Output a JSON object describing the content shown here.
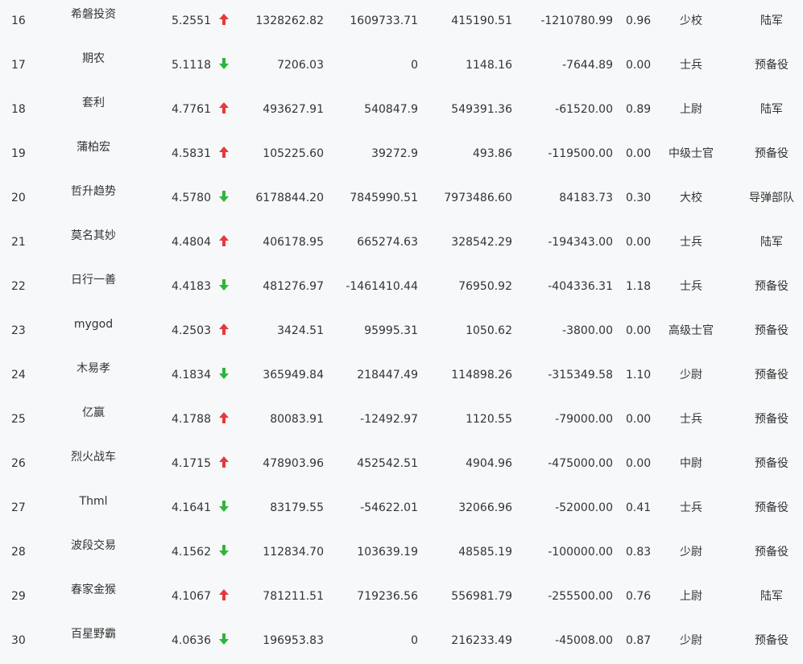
{
  "colors": {
    "up": "#e5393b",
    "down": "#2fb53a",
    "background": "#f7f8fa",
    "text": "#333333"
  },
  "rows": [
    {
      "rank": "16",
      "name": "希磐投资",
      "score": "5.2551",
      "trend": "up",
      "v1": "1328262.82",
      "v2": "1609733.71",
      "v3": "415190.51",
      "v4": "-1210780.99",
      "ratio": "0.96",
      "title": "少校",
      "dept": "陆军"
    },
    {
      "rank": "17",
      "name": "期农",
      "score": "5.1118",
      "trend": "down",
      "v1": "7206.03",
      "v2": "0",
      "v3": "1148.16",
      "v4": "-7644.89",
      "ratio": "0.00",
      "title": "士兵",
      "dept": "预备役"
    },
    {
      "rank": "18",
      "name": "套利",
      "score": "4.7761",
      "trend": "up",
      "v1": "493627.91",
      "v2": "540847.9",
      "v3": "549391.36",
      "v4": "-61520.00",
      "ratio": "0.89",
      "title": "上尉",
      "dept": "陆军"
    },
    {
      "rank": "19",
      "name": "蒲柏宏",
      "score": "4.5831",
      "trend": "up",
      "v1": "105225.60",
      "v2": "39272.9",
      "v3": "493.86",
      "v4": "-119500.00",
      "ratio": "0.00",
      "title": "中级士官",
      "dept": "预备役"
    },
    {
      "rank": "20",
      "name": "哲升趋势",
      "score": "4.5780",
      "trend": "down",
      "v1": "6178844.20",
      "v2": "7845990.51",
      "v3": "7973486.60",
      "v4": "84183.73",
      "ratio": "0.30",
      "title": "大校",
      "dept": "导弹部队"
    },
    {
      "rank": "21",
      "name": "莫名其妙",
      "score": "4.4804",
      "trend": "up",
      "v1": "406178.95",
      "v2": "665274.63",
      "v3": "328542.29",
      "v4": "-194343.00",
      "ratio": "0.00",
      "title": "士兵",
      "dept": "陆军"
    },
    {
      "rank": "22",
      "name": "日行一善",
      "score": "4.4183",
      "trend": "down",
      "v1": "481276.97",
      "v2": "-1461410.44",
      "v3": "76950.92",
      "v4": "-404336.31",
      "ratio": "1.18",
      "title": "士兵",
      "dept": "预备役"
    },
    {
      "rank": "23",
      "name": "mygod",
      "score": "4.2503",
      "trend": "up",
      "v1": "3424.51",
      "v2": "95995.31",
      "v3": "1050.62",
      "v4": "-3800.00",
      "ratio": "0.00",
      "title": "高级士官",
      "dept": "预备役"
    },
    {
      "rank": "24",
      "name": "木易孝",
      "score": "4.1834",
      "trend": "down",
      "v1": "365949.84",
      "v2": "218447.49",
      "v3": "114898.26",
      "v4": "-315349.58",
      "ratio": "1.10",
      "title": "少尉",
      "dept": "预备役"
    },
    {
      "rank": "25",
      "name": "亿赢",
      "score": "4.1788",
      "trend": "up",
      "v1": "80083.91",
      "v2": "-12492.97",
      "v3": "1120.55",
      "v4": "-79000.00",
      "ratio": "0.00",
      "title": "士兵",
      "dept": "预备役"
    },
    {
      "rank": "26",
      "name": "烈火战车",
      "score": "4.1715",
      "trend": "up",
      "v1": "478903.96",
      "v2": "452542.51",
      "v3": "4904.96",
      "v4": "-475000.00",
      "ratio": "0.00",
      "title": "中尉",
      "dept": "预备役"
    },
    {
      "rank": "27",
      "name": "Thml",
      "score": "4.1641",
      "trend": "down",
      "v1": "83179.55",
      "v2": "-54622.01",
      "v3": "32066.96",
      "v4": "-52000.00",
      "ratio": "0.41",
      "title": "士兵",
      "dept": "预备役"
    },
    {
      "rank": "28",
      "name": "波段交易",
      "score": "4.1562",
      "trend": "down",
      "v1": "112834.70",
      "v2": "103639.19",
      "v3": "48585.19",
      "v4": "-100000.00",
      "ratio": "0.83",
      "title": "少尉",
      "dept": "预备役"
    },
    {
      "rank": "29",
      "name": "春家金猴",
      "score": "4.1067",
      "trend": "up",
      "v1": "781211.51",
      "v2": "719236.56",
      "v3": "556981.79",
      "v4": "-255500.00",
      "ratio": "0.76",
      "title": "上尉",
      "dept": "陆军"
    },
    {
      "rank": "30",
      "name": "百星野霸",
      "score": "4.0636",
      "trend": "down",
      "v1": "196953.83",
      "v2": "0",
      "v3": "216233.49",
      "v4": "-45008.00",
      "ratio": "0.87",
      "title": "少尉",
      "dept": "预备役"
    }
  ]
}
